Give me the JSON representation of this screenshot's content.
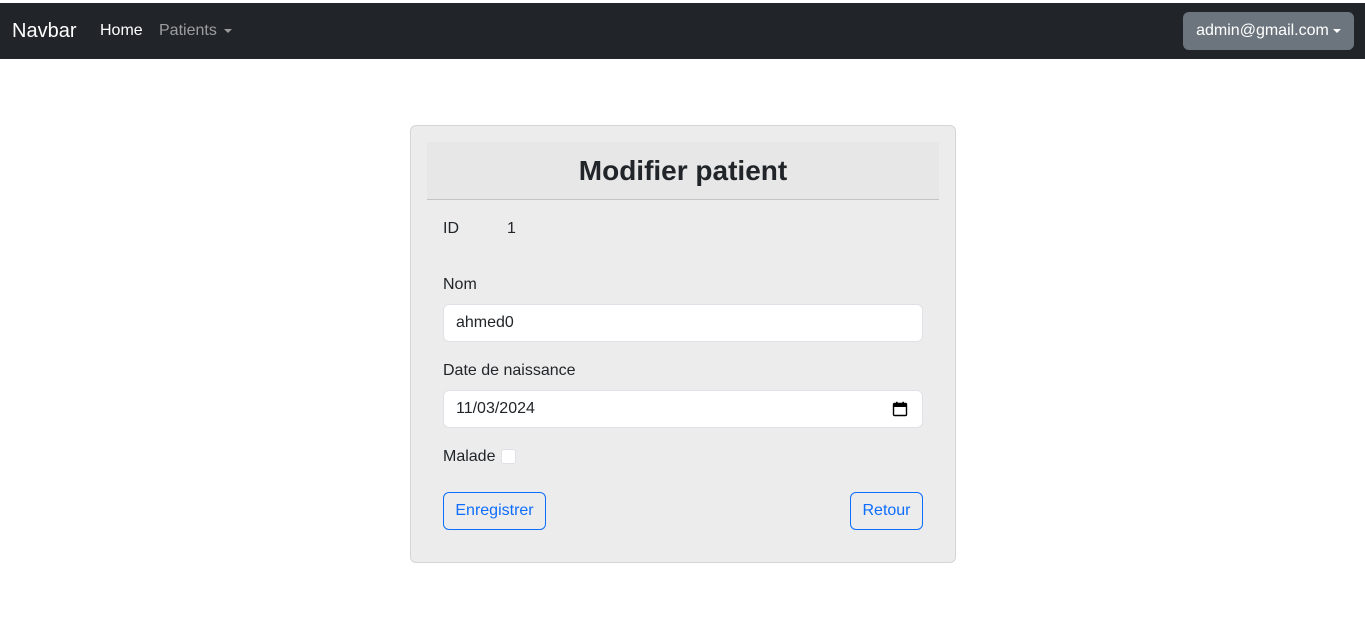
{
  "navbar": {
    "brand": "Navbar",
    "links": {
      "home": "Home",
      "patients": "Patients"
    },
    "user": "admin@gmail.com",
    "colors": {
      "background": "#212529",
      "user_button": "#6c757d"
    }
  },
  "form": {
    "title": "Modifier patient",
    "id_label": "ID",
    "id_value": "1",
    "nom_label": "Nom",
    "nom_value": "ahmed0",
    "date_label": "Date de naissance",
    "date_value": "11/03/2024",
    "date_icon": "calendar-icon",
    "malade_label": "Malade",
    "malade_checked": false,
    "save_label": "Enregistrer",
    "back_label": "Retour",
    "colors": {
      "accent": "#0d6efd",
      "card_background": "#ececec"
    }
  }
}
